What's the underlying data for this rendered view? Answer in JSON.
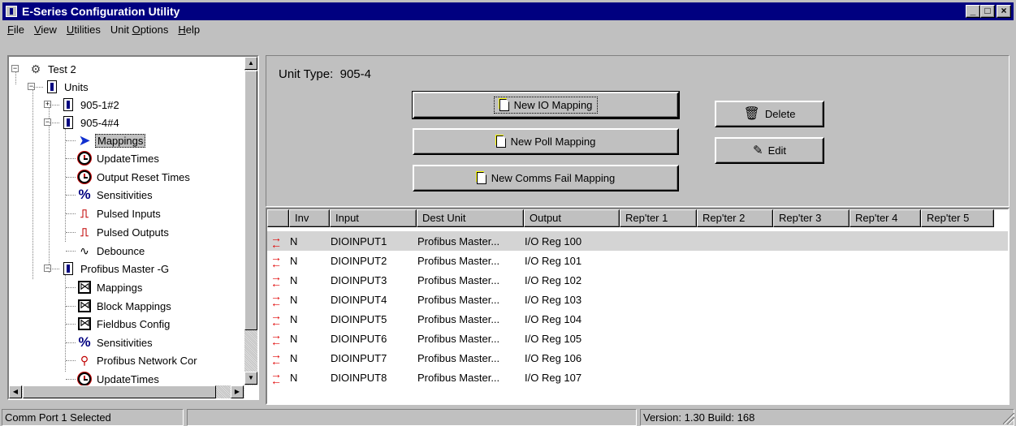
{
  "window": {
    "title": "E-Series Configuration Utility"
  },
  "menu": [
    {
      "label": "File",
      "u": "F",
      "rest": "ile"
    },
    {
      "label": "View",
      "u": "V",
      "rest": "iew"
    },
    {
      "label": "Utilities",
      "u": "U",
      "rest": "tilities"
    },
    {
      "label": "Unit Options",
      "pre": "Unit ",
      "u": "O",
      "rest": "ptions"
    },
    {
      "label": "Help",
      "u": "H",
      "rest": "elp"
    }
  ],
  "tree": {
    "items": [
      {
        "label": "Test 2",
        "icon": "network-icon"
      },
      {
        "label": "Units",
        "icon": "units-icon"
      },
      {
        "label": "905-1#2",
        "icon": "unit-icon"
      },
      {
        "label": "905-4#4",
        "icon": "unit-icon"
      },
      {
        "label": "Mappings",
        "icon": "arrow-icon",
        "selected": true
      },
      {
        "label": "UpdateTimes",
        "icon": "clock-icon"
      },
      {
        "label": "Output Reset Times",
        "icon": "clock-icon"
      },
      {
        "label": "Sensitivities",
        "icon": "percent-icon"
      },
      {
        "label": "Pulsed Inputs",
        "icon": "pulse-icon"
      },
      {
        "label": "Pulsed Outputs",
        "icon": "pulse-icon"
      },
      {
        "label": "Debounce",
        "icon": "debounce-icon"
      },
      {
        "label": "Profibus Master -G",
        "icon": "unit-icon"
      },
      {
        "label": "Mappings",
        "icon": "mapping-icon"
      },
      {
        "label": "Block Mappings",
        "icon": "mapping-icon"
      },
      {
        "label": "Fieldbus Config",
        "icon": "mapping-icon"
      },
      {
        "label": "Sensitivities",
        "icon": "percent-icon"
      },
      {
        "label": "Profibus Network Cor",
        "icon": "network-config-icon"
      },
      {
        "label": "UpdateTimes",
        "icon": "clock-icon"
      }
    ]
  },
  "unit_type": {
    "label": "Unit Type:",
    "value": "905-4"
  },
  "buttons": {
    "new_io": "New IO Mapping",
    "new_poll": "New Poll Mapping",
    "new_comms": "New Comms Fail Mapping",
    "delete": "Delete",
    "edit": "Edit"
  },
  "grid": {
    "columns": [
      "",
      "Inv",
      "Input",
      "Dest Unit",
      "Output",
      "Rep'ter 1",
      "Rep'ter 2",
      "Rep'ter 3",
      "Rep'ter 4",
      "Rep'ter 5"
    ],
    "rows": [
      {
        "inv": "N",
        "input": "DIOINPUT1",
        "dest": "Profibus Master...",
        "output": "I/O Reg 100",
        "selected": true
      },
      {
        "inv": "N",
        "input": "DIOINPUT2",
        "dest": "Profibus Master...",
        "output": "I/O Reg 101"
      },
      {
        "inv": "N",
        "input": "DIOINPUT3",
        "dest": "Profibus Master...",
        "output": "I/O Reg 102"
      },
      {
        "inv": "N",
        "input": "DIOINPUT4",
        "dest": "Profibus Master...",
        "output": "I/O Reg 103"
      },
      {
        "inv": "N",
        "input": "DIOINPUT5",
        "dest": "Profibus Master...",
        "output": "I/O Reg 104"
      },
      {
        "inv": "N",
        "input": "DIOINPUT6",
        "dest": "Profibus Master...",
        "output": "I/O Reg 105"
      },
      {
        "inv": "N",
        "input": "DIOINPUT7",
        "dest": "Profibus Master...",
        "output": "I/O Reg 106"
      },
      {
        "inv": "N",
        "input": "DIOINPUT8",
        "dest": "Profibus Master...",
        "output": "I/O Reg 107"
      }
    ]
  },
  "status": {
    "left": "Comm Port 1 Selected",
    "middle": "",
    "version": "Version: 1.30 Build: 168"
  }
}
